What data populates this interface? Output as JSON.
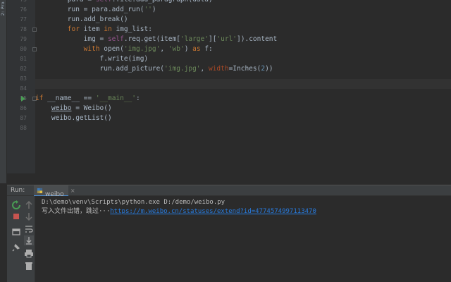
{
  "project_strip": {
    "label": "2: Pro"
  },
  "editor": {
    "lines": [
      {
        "num": "75",
        "segments": [
          {
            "t": "        para = ",
            "c": ""
          },
          {
            "t": "self",
            "c": "self"
          },
          {
            "t": ".file.add_paragraph(data)",
            "c": ""
          }
        ]
      },
      {
        "num": "76",
        "segments": [
          {
            "t": "        run = para.add_run(",
            "c": ""
          },
          {
            "t": "''",
            "c": "str"
          },
          {
            "t": ")",
            "c": ""
          }
        ]
      },
      {
        "num": "77",
        "segments": [
          {
            "t": "        run.add_break()",
            "c": ""
          }
        ]
      },
      {
        "num": "78",
        "segments": [
          {
            "t": "        ",
            "c": ""
          },
          {
            "t": "for",
            "c": "kw"
          },
          {
            "t": " item ",
            "c": ""
          },
          {
            "t": "in",
            "c": "kw"
          },
          {
            "t": " img_list:",
            "c": ""
          }
        ]
      },
      {
        "num": "79",
        "segments": [
          {
            "t": "            img = ",
            "c": ""
          },
          {
            "t": "self",
            "c": "self"
          },
          {
            "t": ".req.get(item[",
            "c": ""
          },
          {
            "t": "'large'",
            "c": "str"
          },
          {
            "t": "][",
            "c": ""
          },
          {
            "t": "'url'",
            "c": "str"
          },
          {
            "t": "]).content",
            "c": ""
          }
        ]
      },
      {
        "num": "80",
        "segments": [
          {
            "t": "            ",
            "c": ""
          },
          {
            "t": "with",
            "c": "kw"
          },
          {
            "t": " open(",
            "c": ""
          },
          {
            "t": "'img.jpg'",
            "c": "str"
          },
          {
            "t": ", ",
            "c": ""
          },
          {
            "t": "'wb'",
            "c": "str"
          },
          {
            "t": ") ",
            "c": ""
          },
          {
            "t": "as",
            "c": "kw"
          },
          {
            "t": " f:",
            "c": ""
          }
        ]
      },
      {
        "num": "81",
        "segments": [
          {
            "t": "                f.write(img)",
            "c": ""
          }
        ]
      },
      {
        "num": "82",
        "segments": [
          {
            "t": "                run.add_picture(",
            "c": ""
          },
          {
            "t": "'img.jpg'",
            "c": "str"
          },
          {
            "t": ", ",
            "c": ""
          },
          {
            "t": "width",
            "c": "param"
          },
          {
            "t": "=Inches(",
            "c": ""
          },
          {
            "t": "2",
            "c": "num"
          },
          {
            "t": "))",
            "c": ""
          }
        ]
      },
      {
        "num": "83",
        "segments": []
      },
      {
        "num": "84",
        "segments": []
      },
      {
        "num": "85",
        "segments": [
          {
            "t": "if",
            "c": "kw"
          },
          {
            "t": " __name__ == ",
            "c": ""
          },
          {
            "t": "'__main__'",
            "c": "str"
          },
          {
            "t": ":",
            "c": ""
          }
        ]
      },
      {
        "num": "86",
        "segments": [
          {
            "t": "    ",
            "c": ""
          },
          {
            "t": "weibo",
            "c": "ul"
          },
          {
            "t": " = Weibo()",
            "c": ""
          }
        ]
      },
      {
        "num": "87",
        "segments": [
          {
            "t": "    weibo.getList()",
            "c": ""
          }
        ]
      },
      {
        "num": "88",
        "segments": []
      }
    ]
  },
  "run_window": {
    "label": "Run:",
    "tab_label": "weibo",
    "tab_close": "×",
    "console": {
      "command": "D:\\demo\\venv\\Scripts\\python.exe D:/demo/weibo.py",
      "message_prefix": "写入文件出错，跳过···",
      "message_link": "https://m.weibo.cn/statuses/extend?id=4774574997113470"
    }
  },
  "icons": {
    "rerun": "rerun-icon",
    "stop": "stop-icon",
    "up": "arrow-up-icon",
    "down": "arrow-down-icon",
    "layout": "layout-icon",
    "soft_wrap": "soft-wrap-icon",
    "scroll_end": "scroll-to-end-icon",
    "pin": "pin-icon",
    "print": "print-icon",
    "trash": "trash-icon"
  },
  "colors": {
    "background": "#2b2b2b",
    "keyword": "#cc7832",
    "string": "#6a8759",
    "self": "#94558d",
    "link": "#287bde",
    "run_green": "#499c54",
    "stop_red": "#c75450"
  }
}
